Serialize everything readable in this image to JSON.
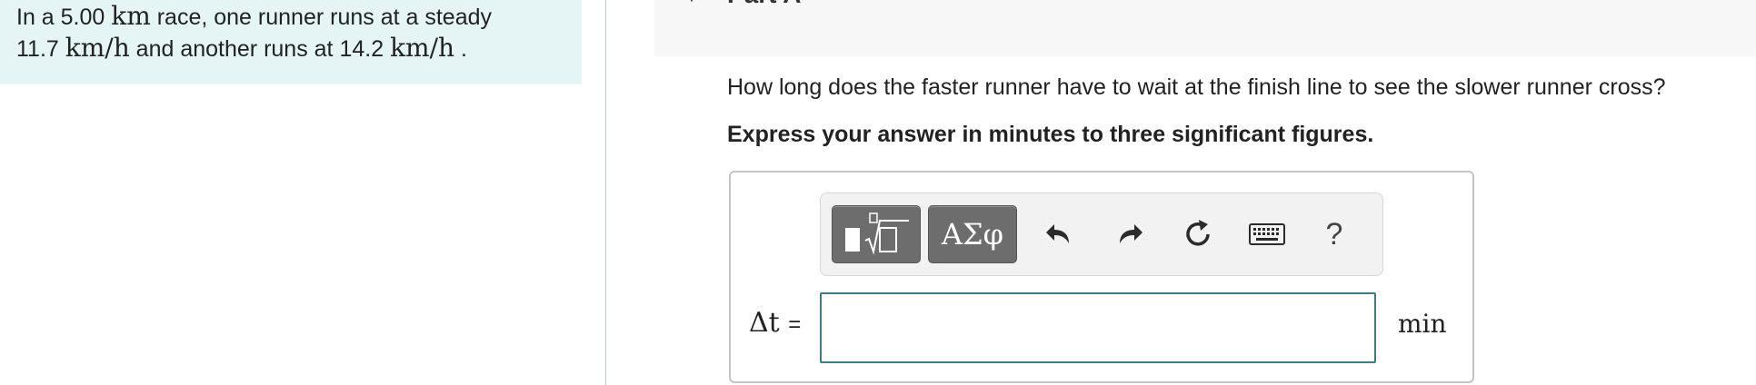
{
  "problem": {
    "line1": {
      "pre": "In a 5.00 ",
      "unit": "km",
      "post": " race, one runner runs at a steady"
    },
    "line2": {
      "speed1": "11.7 ",
      "unit1": "km/h",
      "mid": " and another runs at 14.2 ",
      "unit2": "km/h",
      "end": " ."
    }
  },
  "part": {
    "title": "Part A"
  },
  "question": {
    "text": "How long does the faster runner have to wait at the finish line to see the slower runner cross?",
    "instruction": "Express your answer in minutes to three significant figures."
  },
  "toolbar": {
    "symbols_label": "ΑΣφ",
    "help_label": "?",
    "icons": [
      "templates-icon",
      "greek-symbols-icon",
      "undo-icon",
      "redo-icon",
      "reset-icon",
      "keyboard-icon",
      "help-icon"
    ]
  },
  "answer": {
    "variable": "Δt",
    "equals": "=",
    "value": "",
    "unit": "min"
  },
  "colors": {
    "problem_bg": "#e5f5f5",
    "input_border": "#3b7d86",
    "toolbar_button": "#6d6d6d"
  }
}
